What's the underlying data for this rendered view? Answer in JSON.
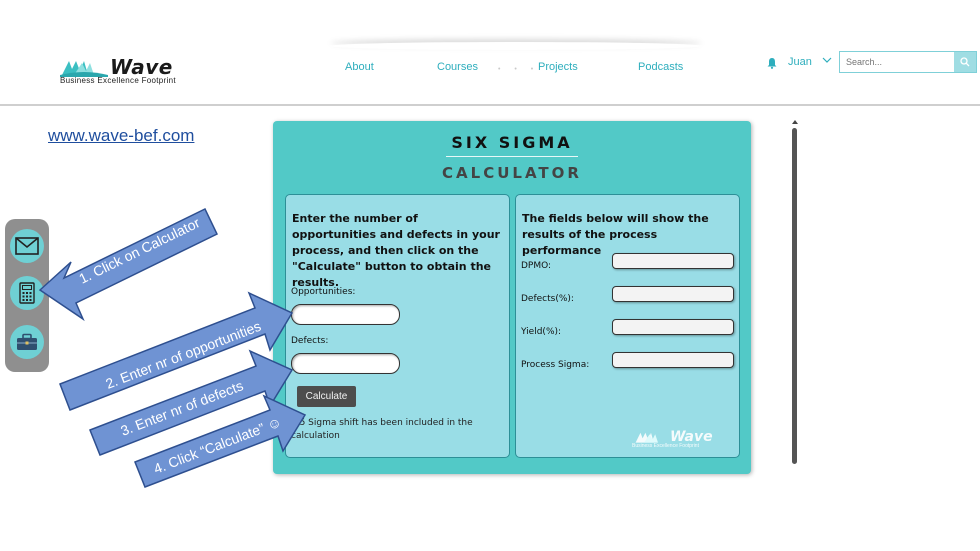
{
  "header": {
    "logo": {
      "word": "Wave",
      "tagline": "Business Excellence Footprint"
    },
    "nav": [
      {
        "label": "About"
      },
      {
        "label": "Courses"
      },
      {
        "label": "Projects"
      },
      {
        "label": "Podcasts"
      }
    ],
    "nav_dots": "• • •",
    "user_name": "Juan",
    "search": {
      "placeholder": "Search..."
    }
  },
  "url_link": "www.wave-bef.com",
  "sidebar": {
    "items": [
      {
        "icon": "mail-icon"
      },
      {
        "icon": "calculator-icon"
      },
      {
        "icon": "briefcase-icon"
      }
    ]
  },
  "calculator": {
    "title_line1": "SIX SIGMA",
    "title_line2": "CALCULATOR",
    "left_panel": {
      "instructions": "Enter the number of opportunities and defects in your process, and then click on the \"Calculate\" button to obtain the results.",
      "opportunities_label": "Opportunities:",
      "opportunities_value": "",
      "defects_label": "Defects:",
      "defects_value": "",
      "calculate_label": "Calculate",
      "note": "1.5 Sigma shift has been included in the calculation"
    },
    "right_panel": {
      "description": "The fields below will show the results of the process performance",
      "fields": [
        {
          "label": "DPMO:",
          "value": ""
        },
        {
          "label": "Defects(%):",
          "value": ""
        },
        {
          "label": "Yield(%):",
          "value": ""
        },
        {
          "label": "Process Sigma:",
          "value": ""
        }
      ],
      "logo_word": "Wave",
      "logo_tagline": "Business Excellence Footprint"
    }
  },
  "annotations": {
    "step1": "1. Click on Calculator",
    "step2": "2. Enter nr of opportunities",
    "step3": "3. Enter nr of defects",
    "step4": "4. Click “Calculate” ☺"
  },
  "colors": {
    "accent": "#2eaebd",
    "calculator_bg": "#52c9c7",
    "panel_bg": "#99dde6",
    "arrow_fill": "#6f93d3",
    "arrow_stroke": "#2e4f8f",
    "link": "#1f4e9e"
  }
}
